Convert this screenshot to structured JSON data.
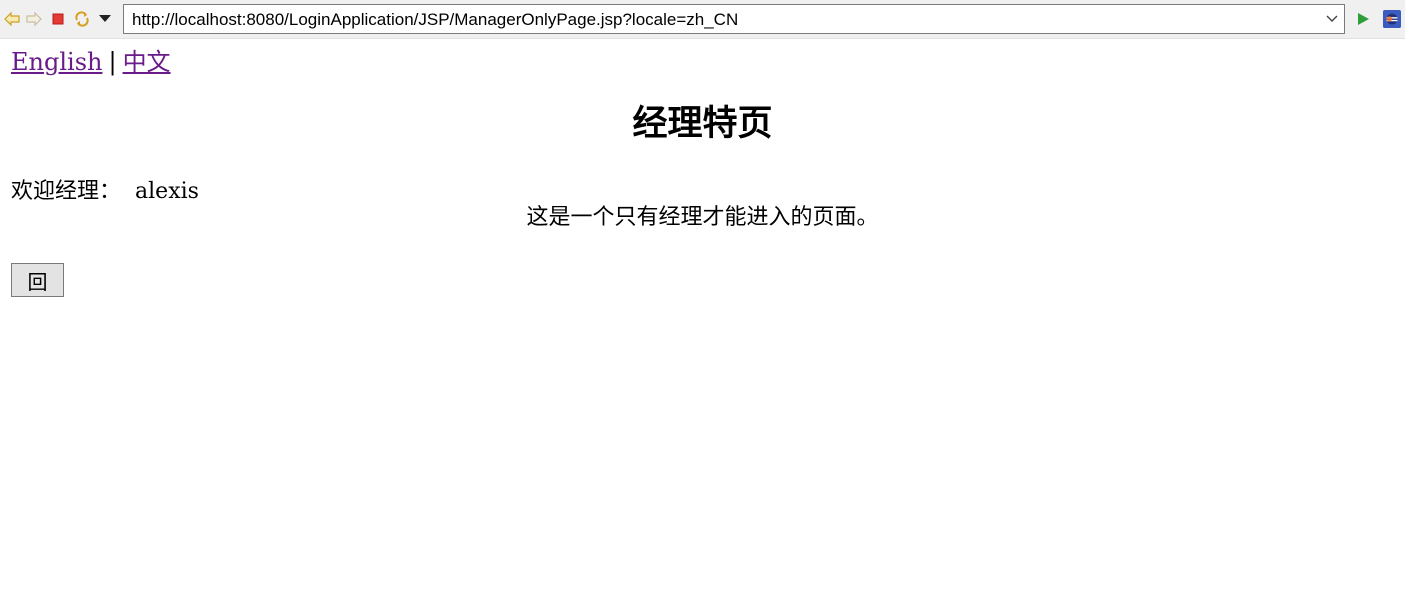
{
  "browser": {
    "url": "http://localhost:8080/LoginApplication/JSP/ManagerOnlyPage.jsp?locale=zh_CN",
    "icons": [
      "back-arrow-icon",
      "forward-arrow-icon",
      "stop-icon",
      "refresh-icon",
      "history-dropdown-icon",
      "url-dropdown-icon",
      "go-icon",
      "eclipse-icon"
    ]
  },
  "language": {
    "english_label": "English",
    "separator": "|",
    "chinese_label": "中文",
    "link_color": "#6a1b8a"
  },
  "page": {
    "title": "经理特页",
    "welcome_label": "欢迎经理：",
    "username": "alexis",
    "message": "这是一个只有经理才能进入的页面。",
    "back_button_label": "回"
  }
}
